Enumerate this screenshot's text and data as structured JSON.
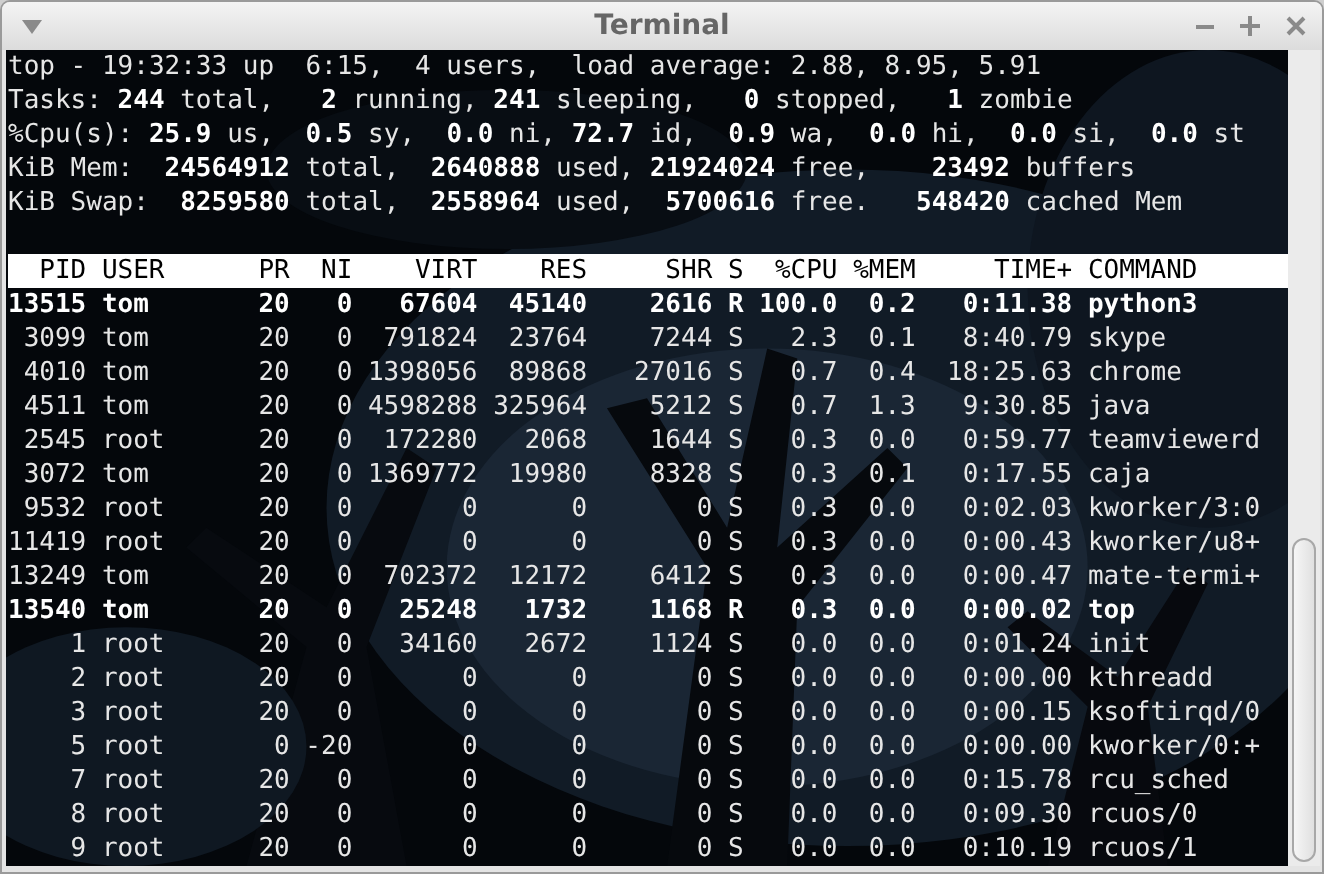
{
  "window": {
    "title": "Terminal"
  },
  "summary": [
    "top - 19:32:33 up  6:15,  4 users,  load average: 2.88, 8.95, 5.91",
    "Tasks: **244** total,   **2** running, **241** sleeping,   **0** stopped,   **1** zombie",
    "%Cpu(s): **25.9** us,  **0.5** sy,  **0.0** ni, **72.7** id,  **0.9** wa,  **0.0** hi,  **0.0** si,  **0.0** st",
    "KiB Mem:  **24564912** total,  **2640888** used, **21924024** free,    **23492** buffers",
    "KiB Swap:  **8259580** total,  **2558964** used,  **5700616** free.   **548420** cached Mem"
  ],
  "table": {
    "columns": [
      "PID",
      "USER",
      "PR",
      "NI",
      "VIRT",
      "RES",
      "SHR",
      "S",
      "%CPU",
      "%MEM",
      "TIME+",
      "COMMAND"
    ],
    "rows": [
      {
        "highlighted": true,
        "cells": [
          "13515",
          "tom",
          "20",
          "0",
          "67604",
          "45140",
          "2616",
          "R",
          "100.0",
          "0.2",
          "0:11.38",
          "python3"
        ]
      },
      {
        "highlighted": false,
        "cells": [
          "3099",
          "tom",
          "20",
          "0",
          "791824",
          "23764",
          "7244",
          "S",
          "2.3",
          "0.1",
          "8:40.79",
          "skype"
        ]
      },
      {
        "highlighted": false,
        "cells": [
          "4010",
          "tom",
          "20",
          "0",
          "1398056",
          "89868",
          "27016",
          "S",
          "0.7",
          "0.4",
          "18:25.63",
          "chrome"
        ]
      },
      {
        "highlighted": false,
        "cells": [
          "4511",
          "tom",
          "20",
          "0",
          "4598288",
          "325964",
          "5212",
          "S",
          "0.7",
          "1.3",
          "9:30.85",
          "java"
        ]
      },
      {
        "highlighted": false,
        "cells": [
          "2545",
          "root",
          "20",
          "0",
          "172280",
          "2068",
          "1644",
          "S",
          "0.3",
          "0.0",
          "0:59.77",
          "teamviewerd"
        ]
      },
      {
        "highlighted": false,
        "cells": [
          "3072",
          "tom",
          "20",
          "0",
          "1369772",
          "19980",
          "8328",
          "S",
          "0.3",
          "0.1",
          "0:17.55",
          "caja"
        ]
      },
      {
        "highlighted": false,
        "cells": [
          "9532",
          "root",
          "20",
          "0",
          "0",
          "0",
          "0",
          "S",
          "0.3",
          "0.0",
          "0:02.03",
          "kworker/3:0"
        ]
      },
      {
        "highlighted": false,
        "cells": [
          "11419",
          "root",
          "20",
          "0",
          "0",
          "0",
          "0",
          "S",
          "0.3",
          "0.0",
          "0:00.43",
          "kworker/u8+"
        ]
      },
      {
        "highlighted": false,
        "cells": [
          "13249",
          "tom",
          "20",
          "0",
          "702372",
          "12172",
          "6412",
          "S",
          "0.3",
          "0.0",
          "0:00.47",
          "mate-termi+"
        ]
      },
      {
        "highlighted": true,
        "cells": [
          "13540",
          "tom",
          "20",
          "0",
          "25248",
          "1732",
          "1168",
          "R",
          "0.3",
          "0.0",
          "0:00.02",
          "top"
        ]
      },
      {
        "highlighted": false,
        "cells": [
          "1",
          "root",
          "20",
          "0",
          "34160",
          "2672",
          "1124",
          "S",
          "0.0",
          "0.0",
          "0:01.24",
          "init"
        ]
      },
      {
        "highlighted": false,
        "cells": [
          "2",
          "root",
          "20",
          "0",
          "0",
          "0",
          "0",
          "S",
          "0.0",
          "0.0",
          "0:00.00",
          "kthreadd"
        ]
      },
      {
        "highlighted": false,
        "cells": [
          "3",
          "root",
          "20",
          "0",
          "0",
          "0",
          "0",
          "S",
          "0.0",
          "0.0",
          "0:00.15",
          "ksoftirqd/0"
        ]
      },
      {
        "highlighted": false,
        "cells": [
          "5",
          "root",
          "0",
          "-20",
          "0",
          "0",
          "0",
          "S",
          "0.0",
          "0.0",
          "0:00.00",
          "kworker/0:+"
        ]
      },
      {
        "highlighted": false,
        "cells": [
          "7",
          "root",
          "20",
          "0",
          "0",
          "0",
          "0",
          "S",
          "0.0",
          "0.0",
          "0:15.78",
          "rcu_sched"
        ]
      },
      {
        "highlighted": false,
        "cells": [
          "8",
          "root",
          "20",
          "0",
          "0",
          "0",
          "0",
          "S",
          "0.0",
          "0.0",
          "0:09.30",
          "rcuos/0"
        ]
      },
      {
        "highlighted": false,
        "cells": [
          "9",
          "root",
          "20",
          "0",
          "0",
          "0",
          "0",
          "S",
          "0.0",
          "0.0",
          "0:10.19",
          "rcuos/1"
        ]
      }
    ]
  }
}
